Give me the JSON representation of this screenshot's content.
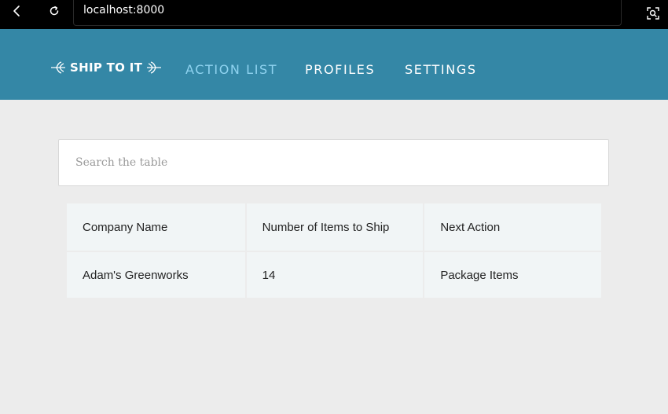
{
  "browser": {
    "url": "localhost:8000"
  },
  "app": {
    "brand": "SHIP TO IT",
    "nav": [
      {
        "label": "ACTION LIST",
        "active": true
      },
      {
        "label": "PROFILES",
        "active": false
      },
      {
        "label": "SETTINGS",
        "active": false
      }
    ],
    "colors": {
      "header": "#3487a6",
      "active_nav": "#8fd3f0",
      "background": "#ececec",
      "table_cell": "#f1f5f6"
    }
  },
  "search": {
    "placeholder": "Search the table",
    "value": ""
  },
  "table": {
    "headers": [
      "Company Name",
      "Number of Items to Ship",
      "Next Action"
    ],
    "rows": [
      [
        "Adam's Greenworks",
        "14",
        "Package Items"
      ]
    ]
  },
  "icons": {
    "back": "chevron-left-icon",
    "reload": "reload-icon",
    "lens": "lens-search-icon",
    "logo_ornament": "wheat-ornament-icon"
  }
}
